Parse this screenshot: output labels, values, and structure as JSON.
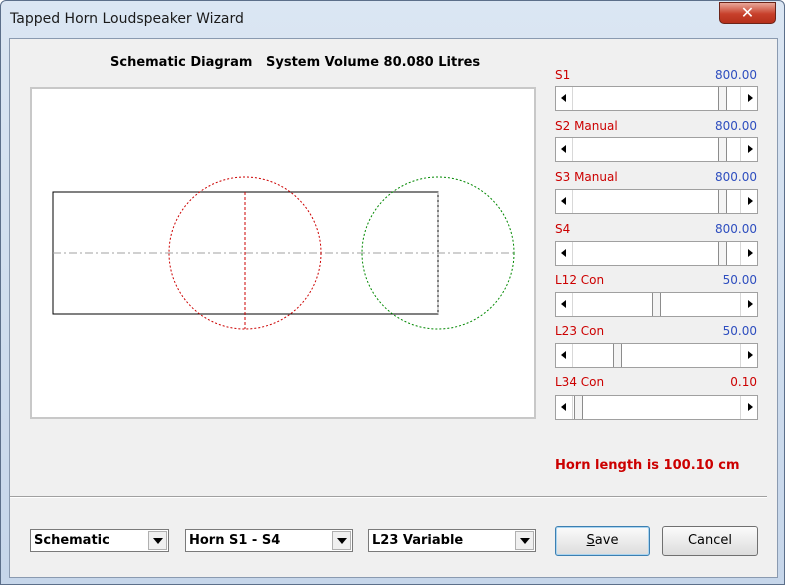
{
  "window": {
    "title": "Tapped Horn Loudspeaker Wizard",
    "close_label": "✕"
  },
  "diagram": {
    "title": "Schematic Diagram   System Volume 80.080 Litres"
  },
  "sliders": [
    {
      "label": "S1",
      "value": "800.00",
      "value_color": "#2e4ebf",
      "position": 0.92
    },
    {
      "label": "S2 Manual",
      "value": "800.00",
      "value_color": "#2e4ebf",
      "position": 0.92
    },
    {
      "label": "S3 Manual",
      "value": "800.00",
      "value_color": "#2e4ebf",
      "position": 0.92
    },
    {
      "label": "S4",
      "value": "800.00",
      "value_color": "#2e4ebf",
      "position": 0.92
    },
    {
      "label": "L12 Con",
      "value": "50.00",
      "value_color": "#2e4ebf",
      "position": 0.5
    },
    {
      "label": "L23 Con",
      "value": "50.00",
      "value_color": "#2e4ebf",
      "position": 0.25
    },
    {
      "label": "L34 Con",
      "value": "0.10",
      "value_color": "#cc0000",
      "position": 0.0
    }
  ],
  "status": {
    "text": "Horn length is 100.10 cm"
  },
  "combos": {
    "view": "Schematic",
    "horn": "Horn S1 - S4",
    "variable": "L23 Variable"
  },
  "buttons": {
    "save": "Save",
    "cancel": "Cancel"
  },
  "colors": {
    "label_red": "#cc0000",
    "value_blue": "#2e4ebf",
    "circle_red": "#cc0000",
    "circle_green": "#008800"
  }
}
